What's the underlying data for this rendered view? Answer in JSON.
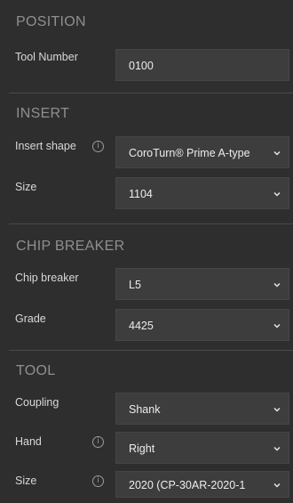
{
  "position": {
    "title": "POSITION",
    "tool_number_label": "Tool Number",
    "tool_number_value": "0100"
  },
  "insert": {
    "title": "INSERT",
    "shape_label": "Insert shape",
    "shape_value": "CoroTurn® Prime A-type",
    "size_label": "Size",
    "size_value": "1104"
  },
  "chip_breaker": {
    "title": "CHIP BREAKER",
    "breaker_label": "Chip breaker",
    "breaker_value": "L5",
    "grade_label": "Grade",
    "grade_value": "4425"
  },
  "tool": {
    "title": "TOOL",
    "coupling_label": "Coupling",
    "coupling_value": "Shank",
    "hand_label": "Hand",
    "hand_value": "Right",
    "size_label": "Size",
    "size_value": "2020 (CP-30AR-2020-1"
  },
  "icons": {
    "info": "info-icon",
    "dropdown": "chevron-down-icon"
  }
}
